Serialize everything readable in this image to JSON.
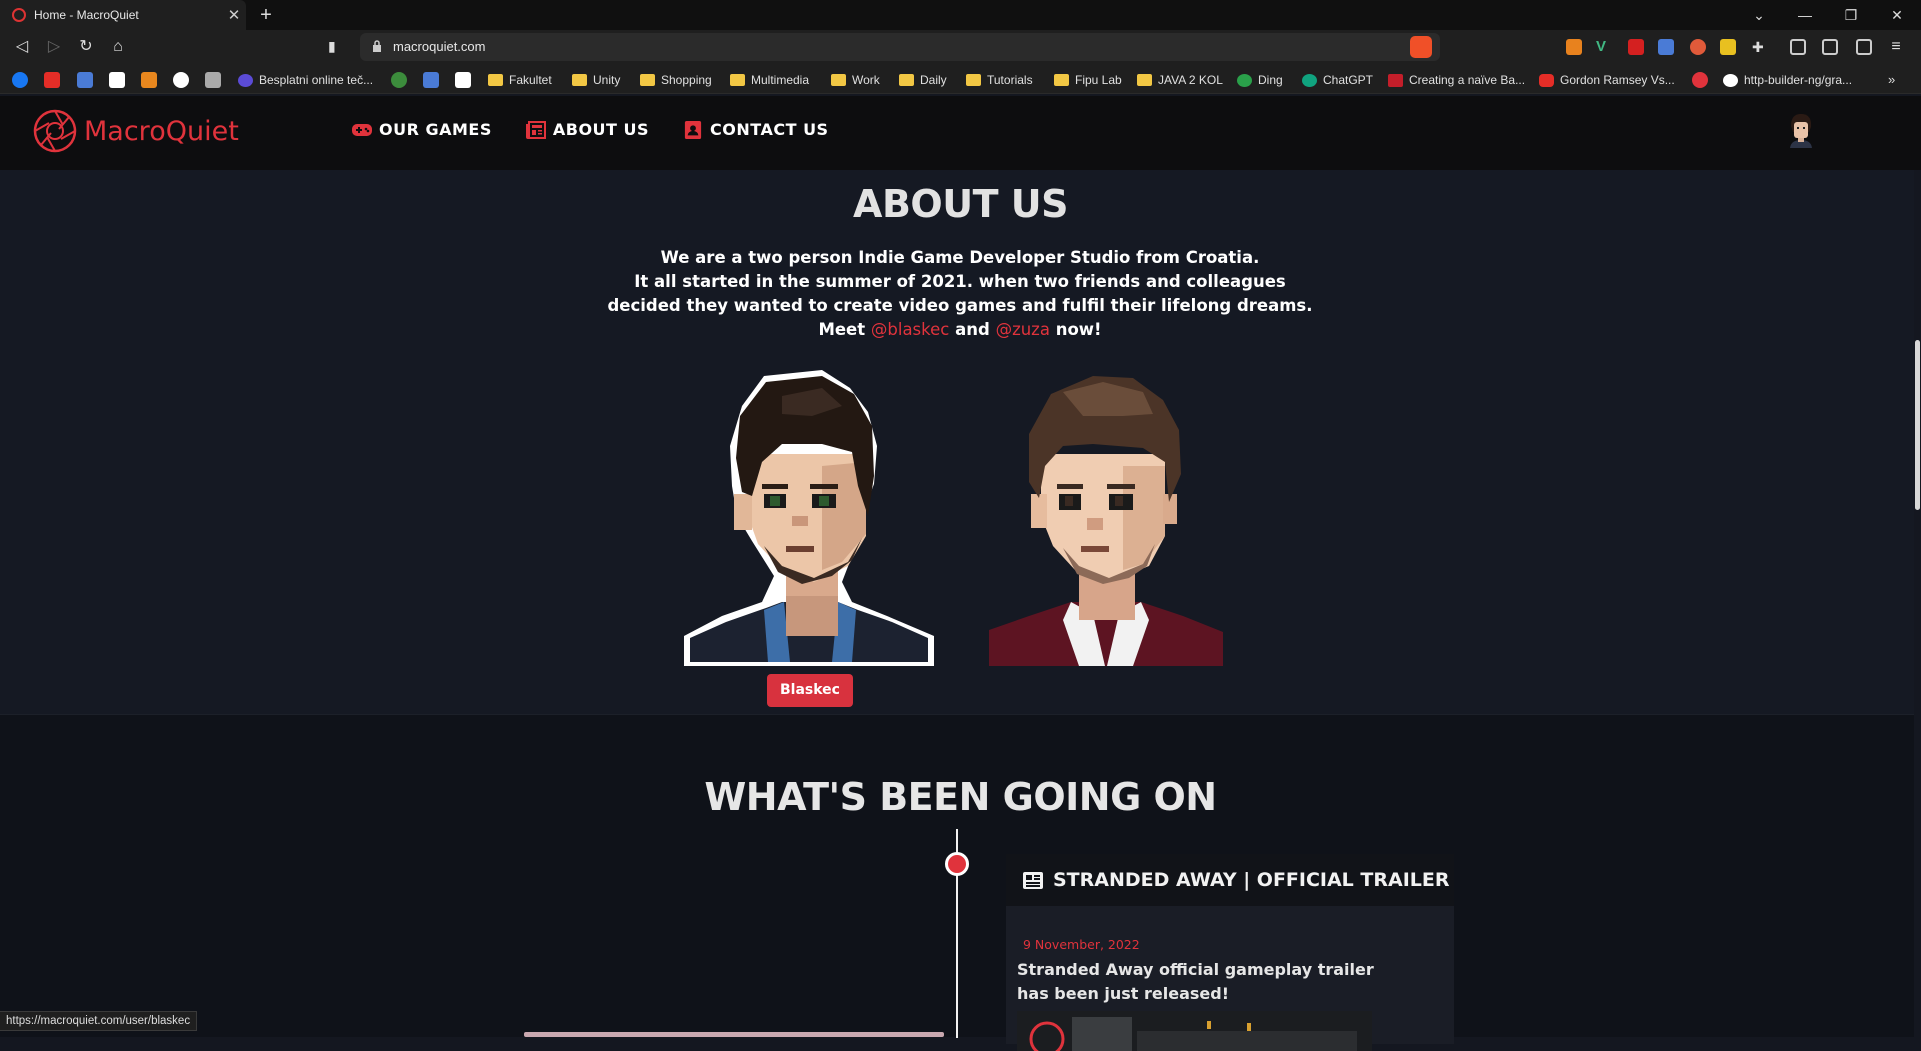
{
  "browser": {
    "tab_title": "Home - MacroQuiet",
    "url": "macroquiet.com",
    "status_url": "https://macroquiet.com/user/blaskec",
    "bookmarks": [
      "Besplatni online teč...",
      "Fakultet",
      "Unity",
      "Shopping",
      "Multimedia",
      "Work",
      "Daily",
      "Tutorials",
      "Fipu Lab",
      "JAVA 2 KOL",
      "Ding",
      "ChatGPT",
      "Creating a naïve Ba...",
      "Gordon Ramsey Vs...",
      "http-builder-ng/gra..."
    ]
  },
  "site": {
    "brand": "MacroQuiet",
    "accent_color": "#e0333c",
    "nav": [
      "OUR GAMES",
      "ABOUT US",
      "CONTACT US"
    ]
  },
  "about": {
    "title": "ABOUT US",
    "line1": "We are a two person Indie Game Developer Studio from Croatia.",
    "line2": "It all started in the summer of 2021. when two friends and colleagues",
    "line3": "decided they wanted to create video games and fulfil their lifelong dreams.",
    "meet_prefix": "Meet",
    "handle1": "@blaskec",
    "and": "and",
    "handle2": "@zuza",
    "meet_suffix": "now!",
    "hover_badge": "Blaskec"
  },
  "timeline": {
    "title": "WHAT'S BEEN GOING ON",
    "card_title": "STRANDED AWAY | OFFICIAL TRAILER",
    "card_date": "9 November, 2022",
    "card_text": "Stranded Away official gameplay trailer has been just released!"
  }
}
